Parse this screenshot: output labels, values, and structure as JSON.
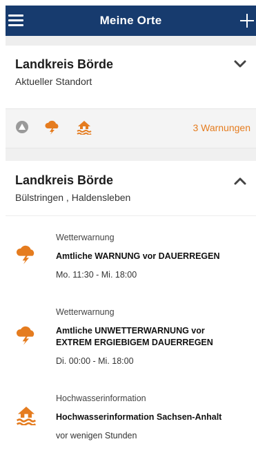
{
  "header": {
    "title": "Meine Orte"
  },
  "location1": {
    "title": "Landkreis Börde",
    "subtitle": "Aktueller Standort",
    "warnings_label": "3 Warnungen",
    "strip_icons": [
      "circle-warning-icon",
      "storm-cloud-icon",
      "flood-house-icon"
    ]
  },
  "location2": {
    "title": "Landkreis Börde",
    "subtitle": "Bülstringen , Haldensleben",
    "warnings": [
      {
        "icon": "storm-cloud-icon",
        "type": "Wetterwarnung",
        "title": "Amtliche WARNUNG vor DAUERREGEN",
        "time": "Mo. 11:30 - Mi. 18:00"
      },
      {
        "icon": "storm-cloud-icon",
        "type": "Wetterwarnung",
        "title": "Amtliche UNWETTERWARNUNG vor EXTREM ERGIEBIGEM DAUERREGEN",
        "time": "Di. 00:00 - Mi. 18:00"
      },
      {
        "icon": "flood-house-icon",
        "type": "Hochwasserinformation",
        "title": "Hochwasserinformation Sachsen-Anhalt",
        "time": "vor wenigen Stunden"
      }
    ]
  },
  "colors": {
    "header": "#173b6e",
    "accent": "#e57c1f"
  }
}
